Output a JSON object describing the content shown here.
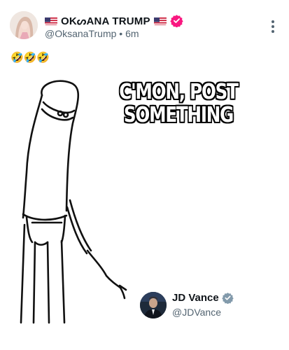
{
  "post": {
    "display_name": "OKᔕANA TRUMP",
    "handle": "@OksanaTrump",
    "time": "6m",
    "separator": "•",
    "flag_icon": "us-flag-icon",
    "verified_icon": "verified-badge-icon",
    "verified_color": "#f91880",
    "body_emoji": "🤣🤣🤣",
    "more_icon": "more-vertical-icon"
  },
  "meme": {
    "caption_line1": "C'MON, POST",
    "caption_line2": "SOMETHING"
  },
  "embedded_account": {
    "name": "JD Vance",
    "handle": "@JDVance",
    "verified_icon": "verified-badge-icon",
    "verified_color": "#829aab"
  }
}
